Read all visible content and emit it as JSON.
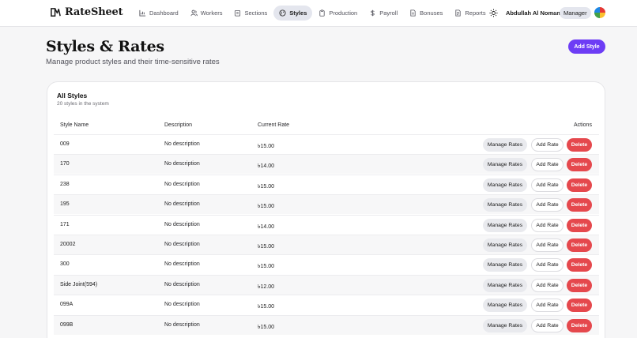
{
  "app": {
    "name": "RateSheet"
  },
  "nav": {
    "items": [
      {
        "label": "Dashboard",
        "icon": "chart-icon",
        "active": false
      },
      {
        "label": "Workers",
        "icon": "users-icon",
        "active": false
      },
      {
        "label": "Sections",
        "icon": "building-icon",
        "active": false
      },
      {
        "label": "Styles",
        "icon": "palette-icon",
        "active": true
      },
      {
        "label": "Production",
        "icon": "clipboard-icon",
        "active": false
      },
      {
        "label": "Payroll",
        "icon": "dollar-icon",
        "active": false
      },
      {
        "label": "Bonuses",
        "icon": "document-icon",
        "active": false
      },
      {
        "label": "Reports",
        "icon": "file-icon",
        "active": false
      }
    ],
    "user_name": "Abdullah Al Noman",
    "role": "Manager"
  },
  "header": {
    "title": "Styles & Rates",
    "subtitle": "Manage product styles and their time-sensitive rates",
    "add_button": "Add Style"
  },
  "card": {
    "title": "All Styles",
    "subtitle": "20 styles in the system",
    "columns": [
      "Style Name",
      "Description",
      "Current Rate",
      "Actions"
    ],
    "rows": [
      {
        "name": "009",
        "description": "No description",
        "rate": "৳15.00"
      },
      {
        "name": "170",
        "description": "No description",
        "rate": "৳14.00"
      },
      {
        "name": "238",
        "description": "No description",
        "rate": "৳15.00"
      },
      {
        "name": "195",
        "description": "No description",
        "rate": "৳15.00"
      },
      {
        "name": "171",
        "description": "No description",
        "rate": "৳14.00"
      },
      {
        "name": "20002",
        "description": "No description",
        "rate": "৳15.00"
      },
      {
        "name": "300",
        "description": "No description",
        "rate": "৳15.00"
      },
      {
        "name": "Side Joint(594)",
        "description": "No description",
        "rate": "৳12.00"
      },
      {
        "name": "099A",
        "description": "No description",
        "rate": "৳15.00"
      },
      {
        "name": "099B",
        "description": "No description",
        "rate": "৳15.00"
      }
    ],
    "actions": {
      "manage": "Manage Rates",
      "add_rate": "Add Rate",
      "delete": "Delete"
    }
  },
  "colors": {
    "accent": "#6d3df5",
    "danger": "#e5484d",
    "active_nav": "#e4e6ee"
  }
}
